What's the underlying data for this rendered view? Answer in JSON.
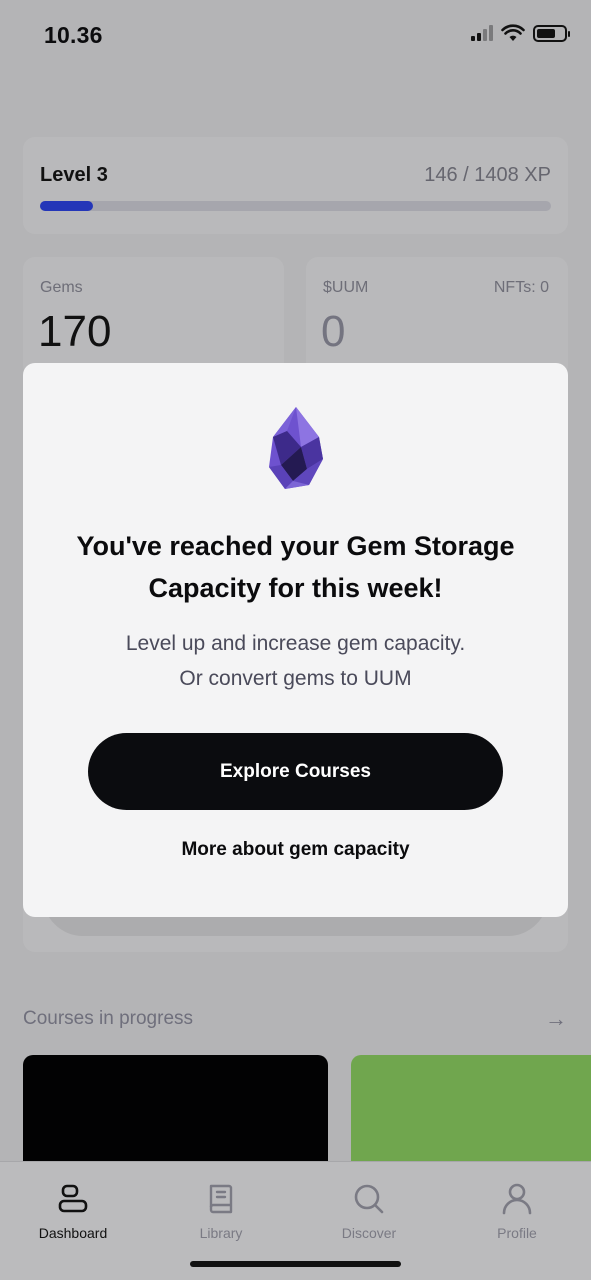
{
  "status_bar": {
    "time": "10.36",
    "icons": [
      "signal-icon",
      "wifi-icon",
      "battery-icon"
    ]
  },
  "dashboard": {
    "level": {
      "title": "Level 3",
      "xp": "146 / 1408 XP",
      "progress_fraction": 0.1037
    },
    "gems": {
      "label": "Gems",
      "value": "170"
    },
    "uum": {
      "label": "$UUM",
      "value": "0",
      "nfts": "NFTs: 0"
    },
    "courses": {
      "header": "Courses in progress",
      "arrow": "→"
    }
  },
  "modal": {
    "icon": "gem-icon",
    "title": "You've reached your Gem Storage Capacity for this week!",
    "subtitle_line1": "Level up and increase gem capacity.",
    "subtitle_line2": "Or convert gems to UUM",
    "primary_button": "Explore Courses",
    "secondary_link": "More about gem capacity"
  },
  "tab_bar": {
    "tabs": [
      {
        "label": "Dashboard",
        "icon": "dashboard-icon",
        "active": true
      },
      {
        "label": "Library",
        "icon": "book-icon",
        "active": false
      },
      {
        "label": "Discover",
        "icon": "search-icon",
        "active": false
      },
      {
        "label": "Profile",
        "icon": "user-icon",
        "active": false
      }
    ]
  },
  "colors": {
    "overlay_background": "#b4b4b6",
    "modal_background": "#f4f4f5",
    "primary_button": "#0b0c0f",
    "xp_fill": "#2436b8",
    "gem_purple": "#6b4fc8",
    "course_card_green": "#70a64e"
  }
}
